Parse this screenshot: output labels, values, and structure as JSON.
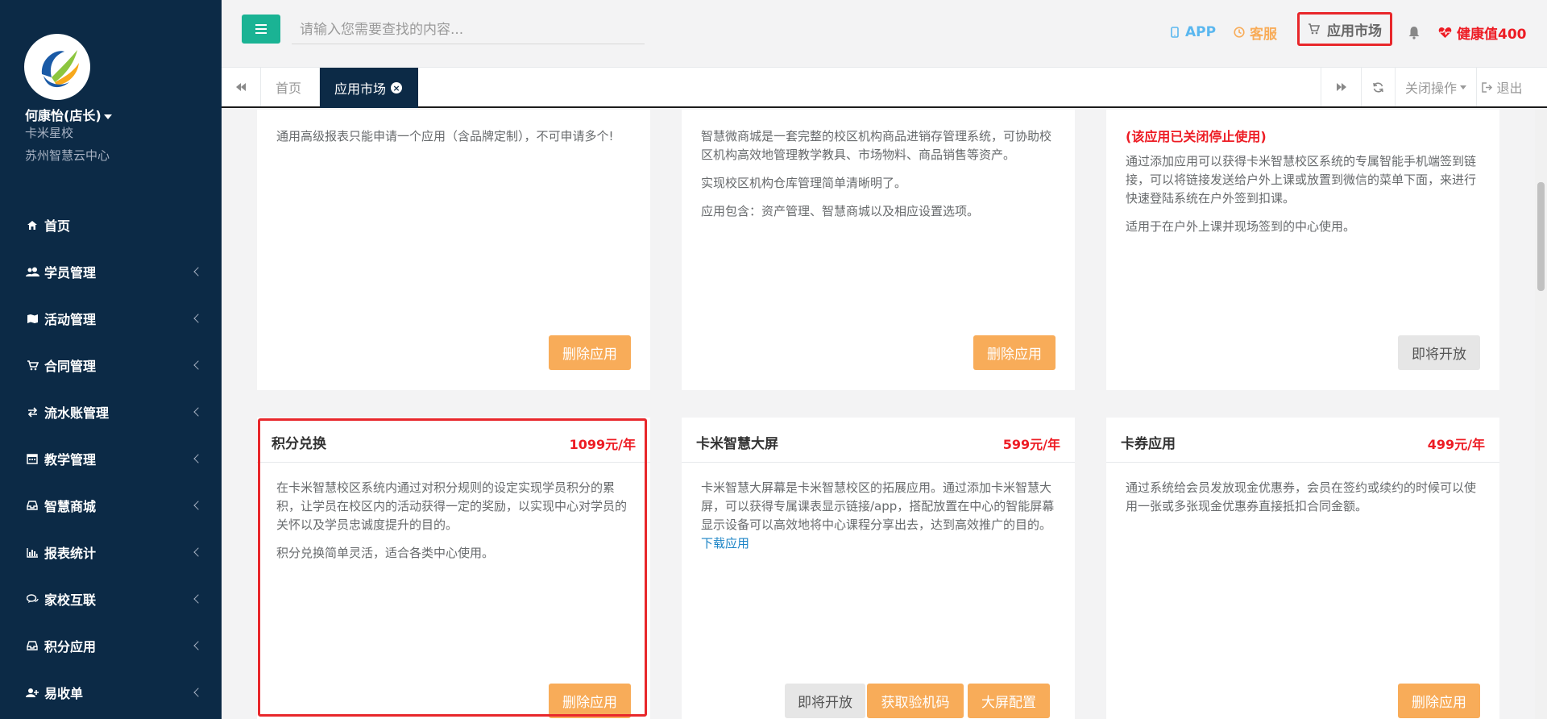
{
  "sidebar": {
    "user_name": "何康怡(店长)",
    "school": "卡米星校",
    "center": "苏州智慧云中心",
    "items": [
      {
        "label": "首页",
        "icon": "home-icon"
      },
      {
        "label": "学员管理",
        "icon": "users-icon"
      },
      {
        "label": "活动管理",
        "icon": "map-icon"
      },
      {
        "label": "合同管理",
        "icon": "cart-icon"
      },
      {
        "label": "流水账管理",
        "icon": "exchange-icon"
      },
      {
        "label": "教学管理",
        "icon": "calendar-icon"
      },
      {
        "label": "智慧商城",
        "icon": "inbox-icon"
      },
      {
        "label": "报表统计",
        "icon": "bar-chart-icon"
      },
      {
        "label": "家校互联",
        "icon": "comments-icon"
      },
      {
        "label": "积分应用",
        "icon": "inbox-icon"
      },
      {
        "label": "易收单",
        "icon": "user-plus-icon"
      }
    ]
  },
  "topbar": {
    "search_placeholder": "请输入您需要查找的内容...",
    "app": "APP",
    "kefu": "客服",
    "market": "应用市场",
    "health": "健康值400"
  },
  "tabs": {
    "home": "首页",
    "active": "应用市场",
    "close_ops": "关闭操作",
    "logout": "退出"
  },
  "cards_top": [
    {
      "body": [
        "通用高级报表只能申请一个应用（含品牌定制），不可申请多个!"
      ],
      "button": "删除应用"
    },
    {
      "body": [
        "智慧微商城是一套完整的校区机构商品进销存管理系统，可协助校区机构高效地管理教学教具、市场物料、商品销售等资产。",
        "实现校区机构仓库管理简单清晰明了。",
        "应用包含：资产管理、智慧商城以及相应设置选项。"
      ],
      "button": "删除应用"
    },
    {
      "closed": "(该应用已关闭停止使用)",
      "body": [
        "通过添加应用可以获得卡米智慧校区系统的专属智能手机端签到链接，可以将链接发送给户外上课或放置到微信的菜单下面，来进行快速登陆系统在户外签到扣课。",
        "适用于在户外上课并现场签到的中心使用。"
      ],
      "button": "即将开放"
    }
  ],
  "cards_bottom": [
    {
      "title": "积分兑换",
      "price": "1099元/年",
      "body": [
        "在卡米智慧校区系统内通过对积分规则的设定实现学员积分的累积，让学员在校区内的活动获得一定的奖励，以实现中心对学员的关怀以及学员忠诚度提升的目的。",
        "积分兑换简单灵活，适合各类中心使用。"
      ],
      "button": "删除应用"
    },
    {
      "title": "卡米智慧大屏",
      "price": "599元/年",
      "body": "卡米智慧大屏幕是卡米智慧校区的拓展应用。通过添加卡米智慧大屏，可以获得专属课表显示链接/app，搭配放置在中心的智能屏幕显示设备可以高效地将中心课程分享出去，达到高效推广的目的。",
      "link": "下载应用",
      "buttons": [
        "即将开放",
        "获取验机码",
        "大屏配置"
      ]
    },
    {
      "title": "卡券应用",
      "price": "499元/年",
      "body": [
        "通过系统给会员发放现金优惠券，会员在签约或续约的时候可以使用一张或多张现金优惠券直接抵扣合同金额。"
      ],
      "button": "删除应用"
    }
  ]
}
